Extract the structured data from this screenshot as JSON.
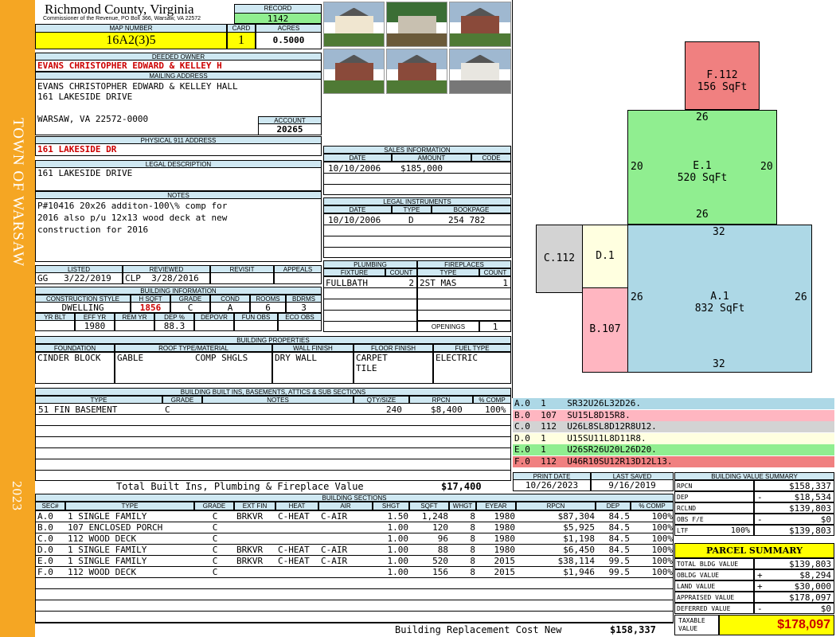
{
  "sidebar": {
    "town": "TOWN OF WARSAW",
    "year": "2023"
  },
  "header": {
    "county": "Richmond County, Virginia",
    "commissioner": "Commissioner of the Revenue, PO Box 366, Warsaw, VA 22572",
    "record_label": "RECORD",
    "record": "1142",
    "map_label": "MAP NUMBER",
    "map_number": "16A2(3)5",
    "card_label": "CARD",
    "card": "1",
    "acres_label": "ACRES",
    "acres": "0.5000"
  },
  "owner": {
    "deeded_label": "DEEDED OWNER",
    "deeded": "EVANS CHRISTOPHER EDWARD & KELLEY H",
    "mailing_label": "MAILING ADDRESS",
    "mail1": "EVANS CHRISTOPHER EDWARD & KELLEY HALL",
    "mail2": "161 LAKESIDE DRIVE",
    "mail3": "WARSAW, VA 22572-0000",
    "account_label": "ACCOUNT",
    "account": "20265",
    "physical_label": "PHYSICAL 911 ADDRESS",
    "physical": "161 LAKESIDE DR",
    "legal_label": "LEGAL DESCRIPTION",
    "legal": "161 LAKESIDE DRIVE",
    "notes_label": "NOTES",
    "notes1": "P#10416 20x26 additon-100\\% comp for",
    "notes2": "2016 also p/u 12x13 wood deck at new",
    "notes3": "construction for 2016"
  },
  "status": {
    "listed_label": "LISTED",
    "listed_by": "GG",
    "listed_date": "3/22/2019",
    "reviewed_label": "REVIEWED",
    "reviewed_by": "CLP",
    "reviewed_date": "3/28/2016",
    "revisit_label": "REVISIT",
    "appeals_label": "APPEALS"
  },
  "building_info": {
    "title": "BUILDING INFORMATION",
    "h_style": "CONSTRUCTION STYLE",
    "h_sqft": "H SQFT",
    "h_grade": "GRADE",
    "h_cond": "COND",
    "h_rooms": "ROOMS",
    "h_bdrms": "BDRMS",
    "style": "DWELLING",
    "sqft": "1856",
    "grade": "C",
    "cond": "A",
    "rooms": "6",
    "bdrms": "3",
    "h_yrblt": "YR BLT",
    "h_effyr": "EFF YR",
    "h_remyr": "REM YR",
    "h_dep": "DEP %",
    "h_depovr": "DEPOVR",
    "h_funobs": "FUN OBS",
    "h_ecoobs": "ECO OBS",
    "effyr": "1980",
    "dep": "88.3"
  },
  "sales": {
    "title": "SALES INFORMATION",
    "h_date": "DATE",
    "h_amount": "AMOUNT",
    "h_code": "CODE",
    "date": "10/10/2006",
    "amount": "$185,000"
  },
  "legal_instr": {
    "title": "LEGAL INSTRUMENTS",
    "h_date": "DATE",
    "h_type": "TYPE",
    "h_book": "BOOKPAGE",
    "date": "10/10/2006",
    "type": "D",
    "book": "254 782"
  },
  "plumbing": {
    "title": "PLUMBING",
    "h_fixture": "FIXTURE",
    "h_count": "COUNT",
    "fixture": "FULLBATH",
    "count": "2"
  },
  "fireplaces": {
    "title": "FIREPLACES",
    "h_type": "TYPE",
    "h_count": "COUNT",
    "type": "2ST MAS",
    "count": "1",
    "openings_label": "OPENINGS",
    "openings": "1"
  },
  "properties": {
    "title": "BUILDING PROPERTIES",
    "h_foundation": "FOUNDATION",
    "h_roof": "ROOF TYPE/MATERIAL",
    "h_wall": "WALL FINISH",
    "h_floor": "FLOOR FINISH",
    "h_fuel": "FUEL TYPE",
    "foundation": "CINDER BLOCK",
    "roof_type": "GABLE",
    "roof_mat": "COMP SHGLS",
    "wall": "DRY WALL",
    "floor1": "CARPET",
    "floor2": "TILE",
    "fuel": "ELECTRIC"
  },
  "builtins": {
    "title": "BUILDING BUILT INS, BASEMENTS, ATTICS & SUB SECTIONS",
    "h_type": "TYPE",
    "h_grade": "GRADE",
    "h_notes": "NOTES",
    "h_qty": "QTY/SIZE",
    "h_rpcn": "RPCN",
    "h_comp": "% COMP",
    "type": "51 FIN BASEMENT",
    "grade": "C",
    "qty": "240",
    "rpcn": "$8,400",
    "comp": "100%",
    "total_label": "Total Built Ins, Plumbing & Fireplace Value",
    "total": "$17,400"
  },
  "print": {
    "h_print": "PRINT DATE",
    "h_saved": "LAST SAVED",
    "print_date": "10/26/2023",
    "last_saved": "9/16/2019"
  },
  "sections": {
    "title": "BUILDING SECTIONS",
    "headers": [
      "SEC#",
      "TYPE",
      "GRADE",
      "EXT FIN",
      "HEAT",
      "AIR",
      "SHGT",
      "SQFT",
      "WHGT",
      "EYEAR",
      "RPCN",
      "DEP",
      "% COMP"
    ],
    "rows": [
      [
        "A.0",
        "1 SINGLE FAMILY",
        "C",
        "BRKVR",
        "C-HEAT",
        "C-AIR",
        "1.50",
        "1,248",
        "8",
        "1980",
        "$87,304",
        "84.5",
        "100%"
      ],
      [
        "B.0",
        "107 ENCLOSED PORCH",
        "C",
        "",
        "",
        "",
        "1.00",
        "120",
        "8",
        "1980",
        "$5,925",
        "84.5",
        "100%"
      ],
      [
        "C.0",
        "112 WOOD DECK",
        "C",
        "",
        "",
        "",
        "1.00",
        "96",
        "8",
        "1980",
        "$1,198",
        "84.5",
        "100%"
      ],
      [
        "D.0",
        "1 SINGLE FAMILY",
        "C",
        "BRKVR",
        "C-HEAT",
        "C-AIR",
        "1.00",
        "88",
        "8",
        "1980",
        "$6,450",
        "84.5",
        "100%"
      ],
      [
        "E.0",
        "1 SINGLE FAMILY",
        "C",
        "BRKVR",
        "C-HEAT",
        "C-AIR",
        "1.00",
        "520",
        "8",
        "2015",
        "$38,114",
        "99.5",
        "100%"
      ],
      [
        "F.0",
        "112 WOOD DECK",
        "C",
        "",
        "",
        "",
        "1.00",
        "156",
        "8",
        "2015",
        "$1,946",
        "99.5",
        "100%"
      ]
    ],
    "total_label": "Building Replacement Cost New",
    "total": "$158,337"
  },
  "segments": [
    {
      "text": "A.0  1    SR32U26L32D26.",
      "color": "#add8e6"
    },
    {
      "text": "B.0  107  SU15L8D15R8.",
      "color": "#ffb6c1"
    },
    {
      "text": "C.0  112  U26L8SL8D12R8U12.",
      "color": "#d3d3d3"
    },
    {
      "text": "D.0  1    U15SU11L8D11R8.",
      "color": "#ffffe0"
    },
    {
      "text": "E.0  1    U26SR26U20L26D20.",
      "color": "#90ee90"
    },
    {
      "text": "F.0  112  U46R10SU12R13D12L13.",
      "color": "#f08080"
    }
  ],
  "sketch": {
    "f_label": "F.112",
    "f_area": "156 SqFt",
    "e_label": "E.1",
    "e_area": "520 SqFt",
    "a_label": "A.1",
    "a_area": "832 SqFt",
    "b_label": "B.107",
    "c_label": "C.112",
    "d_label": "D.1",
    "d26t": "26",
    "d20l": "20",
    "d20r": "20",
    "d26b": "26",
    "d32t": "32",
    "d26l": "26",
    "d26r": "26",
    "d32b": "32"
  },
  "value_summary": {
    "title": "BUILDING VALUE SUMMARY",
    "rows": [
      {
        "label": "RPCN",
        "sign": "",
        "pct": "",
        "value": "$158,337"
      },
      {
        "label": "DEP",
        "sign": "-",
        "pct": "",
        "value": "$18,534"
      },
      {
        "label": "RCLND",
        "sign": "",
        "pct": "",
        "value": "$139,803"
      },
      {
        "label": "OBS F/E",
        "sign": "-",
        "pct": "",
        "value": "$0"
      },
      {
        "label": "LTF",
        "sign": "",
        "pct": "100%",
        "value": "$139,803"
      }
    ]
  },
  "parcel": {
    "title": "PARCEL SUMMARY",
    "rows": [
      {
        "label": "TOTAL BLDG VALUE",
        "sign": "",
        "value": "$139,803"
      },
      {
        "label": "OBLDG VALUE",
        "sign": "+",
        "value": "$8,294"
      },
      {
        "label": "LAND VALUE",
        "sign": "+",
        "value": "$30,000"
      },
      {
        "label": "APPRAISED VALUE",
        "sign": "",
        "value": "$178,097"
      },
      {
        "label": "DEFERRED VALUE",
        "sign": "-",
        "value": "$0"
      }
    ],
    "taxable_label": "TAXABLE VALUE",
    "taxable": "$178,097"
  },
  "colors": {
    "sidebar": "#f5a623",
    "header": "#cfe8f2",
    "highlight": "#ffff00",
    "record": "#90ee90"
  }
}
